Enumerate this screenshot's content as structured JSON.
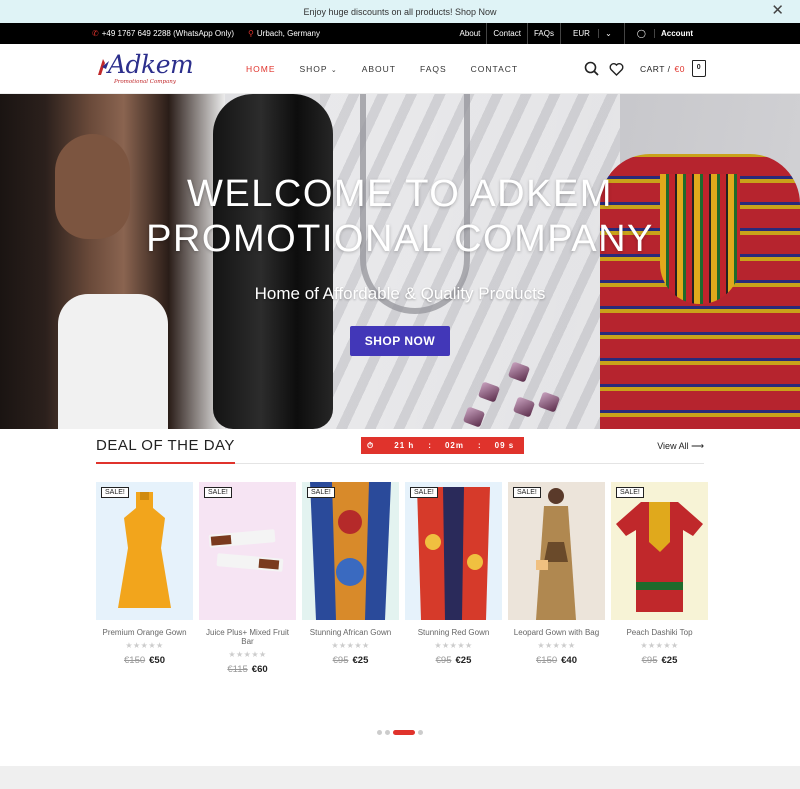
{
  "announcement": {
    "text": "Enjoy huge discounts on all products! Shop Now"
  },
  "topbar": {
    "phone": "+49 1767 649 2288 (WhatsApp Only)",
    "location": "Urbach, Germany",
    "links": [
      "About",
      "Contact",
      "FAQs"
    ],
    "currency": "EUR",
    "account": "Account"
  },
  "brand": {
    "name": "Adkem",
    "tagline": "Promotional Company"
  },
  "nav": [
    "HOME",
    "SHOP",
    "ABOUT",
    "FAQS",
    "CONTACT"
  ],
  "cart": {
    "label": "CART /",
    "amount": "€0",
    "count": "0"
  },
  "hero": {
    "title_line1": "WELCOME TO ADKEM",
    "title_line2": "PROMOTIONAL COMPANY",
    "subtitle": "Home of Affordable & Quality Products",
    "button": "SHOP NOW"
  },
  "deals": {
    "title": "DEAL OF THE DAY",
    "timer": {
      "hours": "21",
      "h_label": "h",
      "minutes": "02m",
      "seconds": "09",
      "s_label": "s"
    },
    "view_all": "View All",
    "badge": "SALE!",
    "stars": "★★★★★",
    "products": [
      {
        "name": "Premium Orange Gown",
        "old_price": "€150",
        "price": "€50",
        "bg": "#e6f2fb"
      },
      {
        "name": "Juice Plus+ Mixed Fruit Bar",
        "old_price": "€115",
        "price": "€60",
        "bg": "#f6e4f3"
      },
      {
        "name": "Stunning African Gown",
        "old_price": "€95",
        "price": "€25",
        "bg": "#e3f3f0"
      },
      {
        "name": "Stunning Red Gown",
        "old_price": "€95",
        "price": "€25",
        "bg": "#e6f2fb"
      },
      {
        "name": "Leopard Gown with Bag",
        "old_price": "€150",
        "price": "€40",
        "bg": "#f3e6df"
      },
      {
        "name": "Peach Dashiki Top",
        "old_price": "€95",
        "price": "€25",
        "bg": "#f7f3d6"
      }
    ]
  },
  "colors": {
    "accent": "#e0332c",
    "button": "#4237b8",
    "brand": "#2c2f8c"
  }
}
